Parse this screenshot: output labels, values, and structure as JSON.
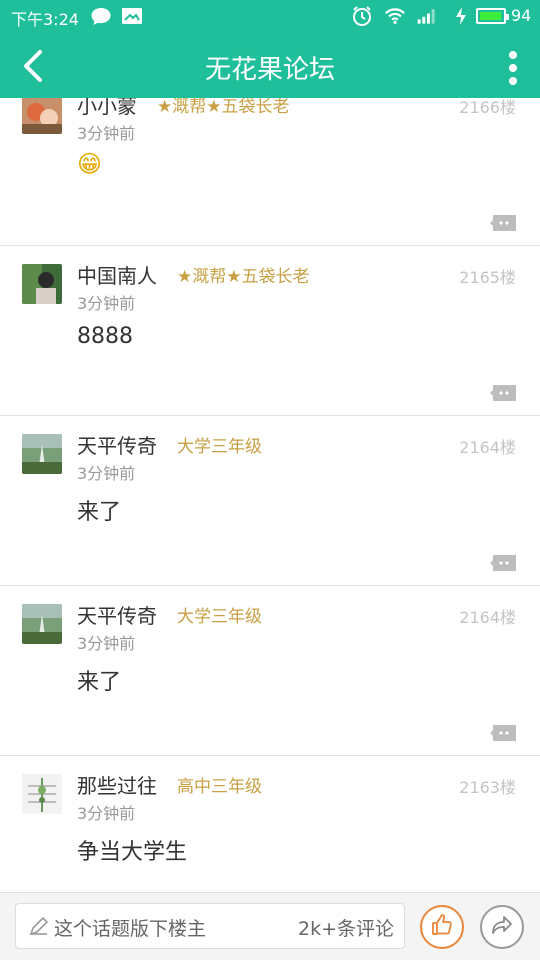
{
  "status_bar": {
    "time": "下午3:24",
    "battery_percent": "94",
    "battery_level": 0.94,
    "icons": [
      "chat-bubble-icon",
      "mail-icon",
      "alarm-icon",
      "wifi-icon",
      "signal-icon",
      "charging-icon"
    ]
  },
  "header": {
    "title": "无花果论坛",
    "back_icon": "chevron-left-icon",
    "menu_icon": "more-vertical-icon"
  },
  "posts": [
    {
      "user": "小小蒙",
      "badge": "★溉帮★五袋长老",
      "time": "3分钟前",
      "floor": "2166楼",
      "content": "😁",
      "content_type": "emoji"
    },
    {
      "user": "中国南人",
      "badge": "★溉帮★五袋长老",
      "time": "3分钟前",
      "floor": "2165楼",
      "content": "8888"
    },
    {
      "user": "天平传奇",
      "badge": "大学三年级",
      "time": "3分钟前",
      "floor": "2164楼",
      "content": "来了"
    },
    {
      "user": "天平传奇",
      "badge": "大学三年级",
      "time": "3分钟前",
      "floor": "2164楼",
      "content": "来了"
    },
    {
      "user": "那些过往",
      "badge": "高中三年级",
      "time": "3分钟前",
      "floor": "2163楼",
      "content": "争当大学生"
    }
  ],
  "bottom_bar": {
    "placeholder": "这个话题版下楼主",
    "comment_count": "2k+条评论",
    "like_icon": "thumbs-up-icon",
    "share_icon": "share-arrow-icon"
  },
  "colors": {
    "primary": "#1fbf9c",
    "badge": "#c8a043",
    "like": "#e8853a"
  }
}
